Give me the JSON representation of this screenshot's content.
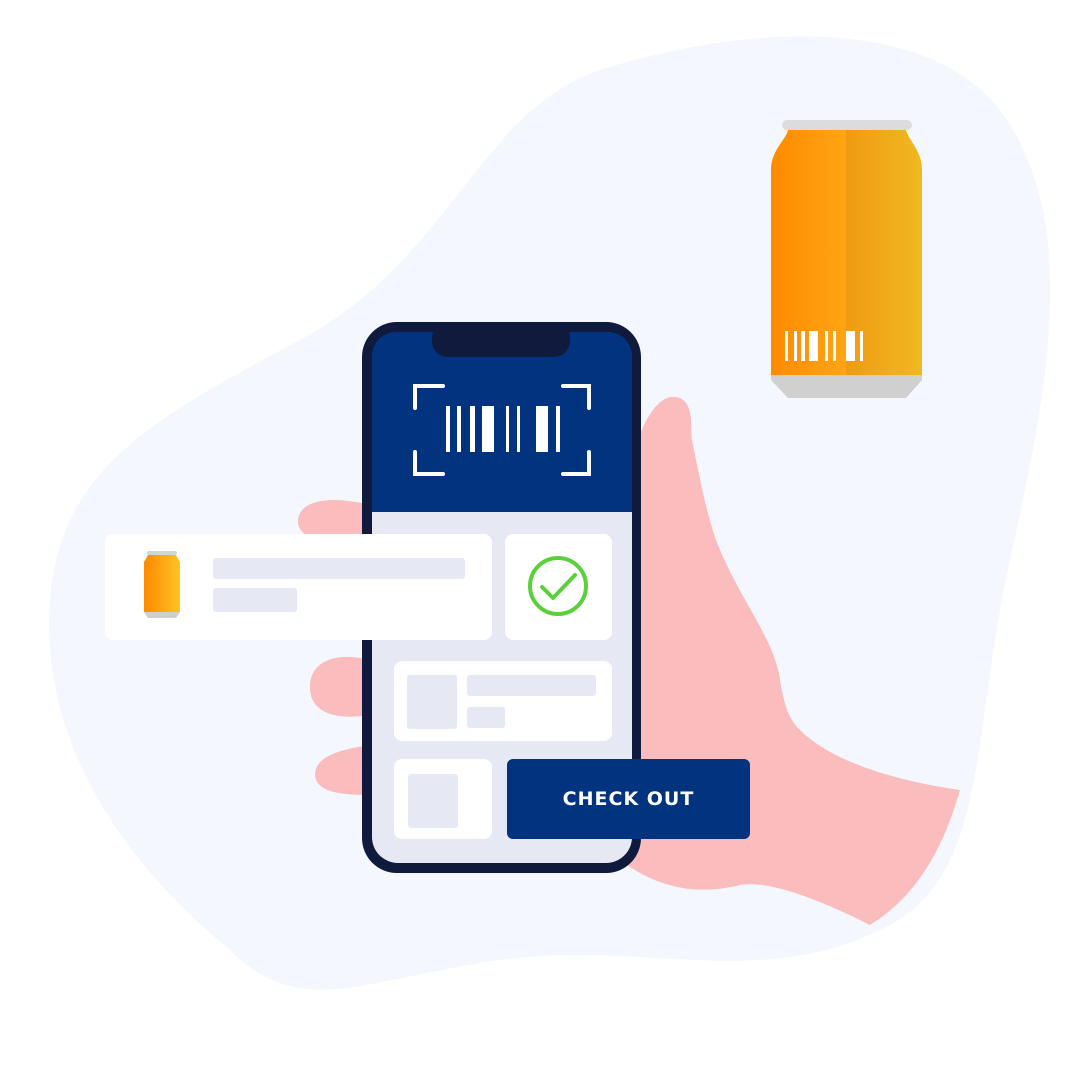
{
  "checkout_button": {
    "label": "CHECK OUT"
  },
  "colors": {
    "background_blob": "#f4f7fd",
    "hand": "#fbbcbd",
    "phone_frame": "#0f1a3c",
    "screen_header": "#02337f",
    "screen_body": "#e6e8f3",
    "check_green": "#5ad13a",
    "can_orange": "#ff8c00",
    "can_yellow": "#ffc320"
  },
  "icons": {
    "scan": "barcode-scan-icon",
    "status": "check-circle-icon",
    "product": "soda-can-icon"
  }
}
